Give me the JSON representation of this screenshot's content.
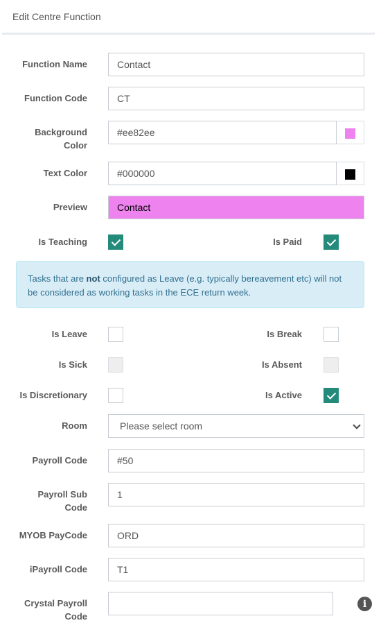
{
  "header": {
    "title": "Edit Centre Function"
  },
  "form": {
    "function_name": {
      "label": "Function Name",
      "value": "Contact"
    },
    "function_code": {
      "label": "Function Code",
      "value": "CT"
    },
    "background_color": {
      "label_line1": "Background",
      "label_line2": "Color",
      "value": "#ee82ee",
      "swatch": "#ee82ee"
    },
    "text_color": {
      "label": "Text Color",
      "value": "#000000",
      "swatch": "#000000"
    },
    "preview": {
      "label": "Preview",
      "value": "Contact",
      "bg": "#ee82ee",
      "fg": "#000000"
    },
    "is_teaching": {
      "label": "Is Teaching",
      "checked": true
    },
    "is_paid": {
      "label": "Is Paid",
      "checked": true
    },
    "alert": {
      "part1": "Tasks that are ",
      "bold": "not",
      "part2": " configured as Leave (e.g. typically bereavement etc) will not be considered as working tasks in the ECE return week."
    },
    "is_leave": {
      "label": "Is Leave",
      "checked": false
    },
    "is_break": {
      "label": "Is Break",
      "checked": false
    },
    "is_sick": {
      "label": "Is Sick",
      "checked": false,
      "disabled": true
    },
    "is_absent": {
      "label": "Is Absent",
      "checked": false,
      "disabled": true
    },
    "is_discretionary": {
      "label": "Is Discretionary",
      "checked": false
    },
    "is_active": {
      "label": "Is Active",
      "checked": true
    },
    "room": {
      "label": "Room",
      "selected": "Please select room"
    },
    "payroll_code": {
      "label": "Payroll Code",
      "value": "#50"
    },
    "payroll_sub_code": {
      "label_line1": "Payroll Sub",
      "label_line2": "Code",
      "value": "1"
    },
    "myob_paycode": {
      "label": "MYOB PayCode",
      "value": "ORD"
    },
    "ipayroll_code": {
      "label": "iPayroll Code",
      "value": "T1"
    },
    "crystal_payroll_code": {
      "label_line1": "Crystal Payroll",
      "label_line2": "Code",
      "value": ""
    }
  },
  "icons": {
    "info": "info-icon",
    "check": "check-icon",
    "dropdown": "chevron-down-icon"
  }
}
